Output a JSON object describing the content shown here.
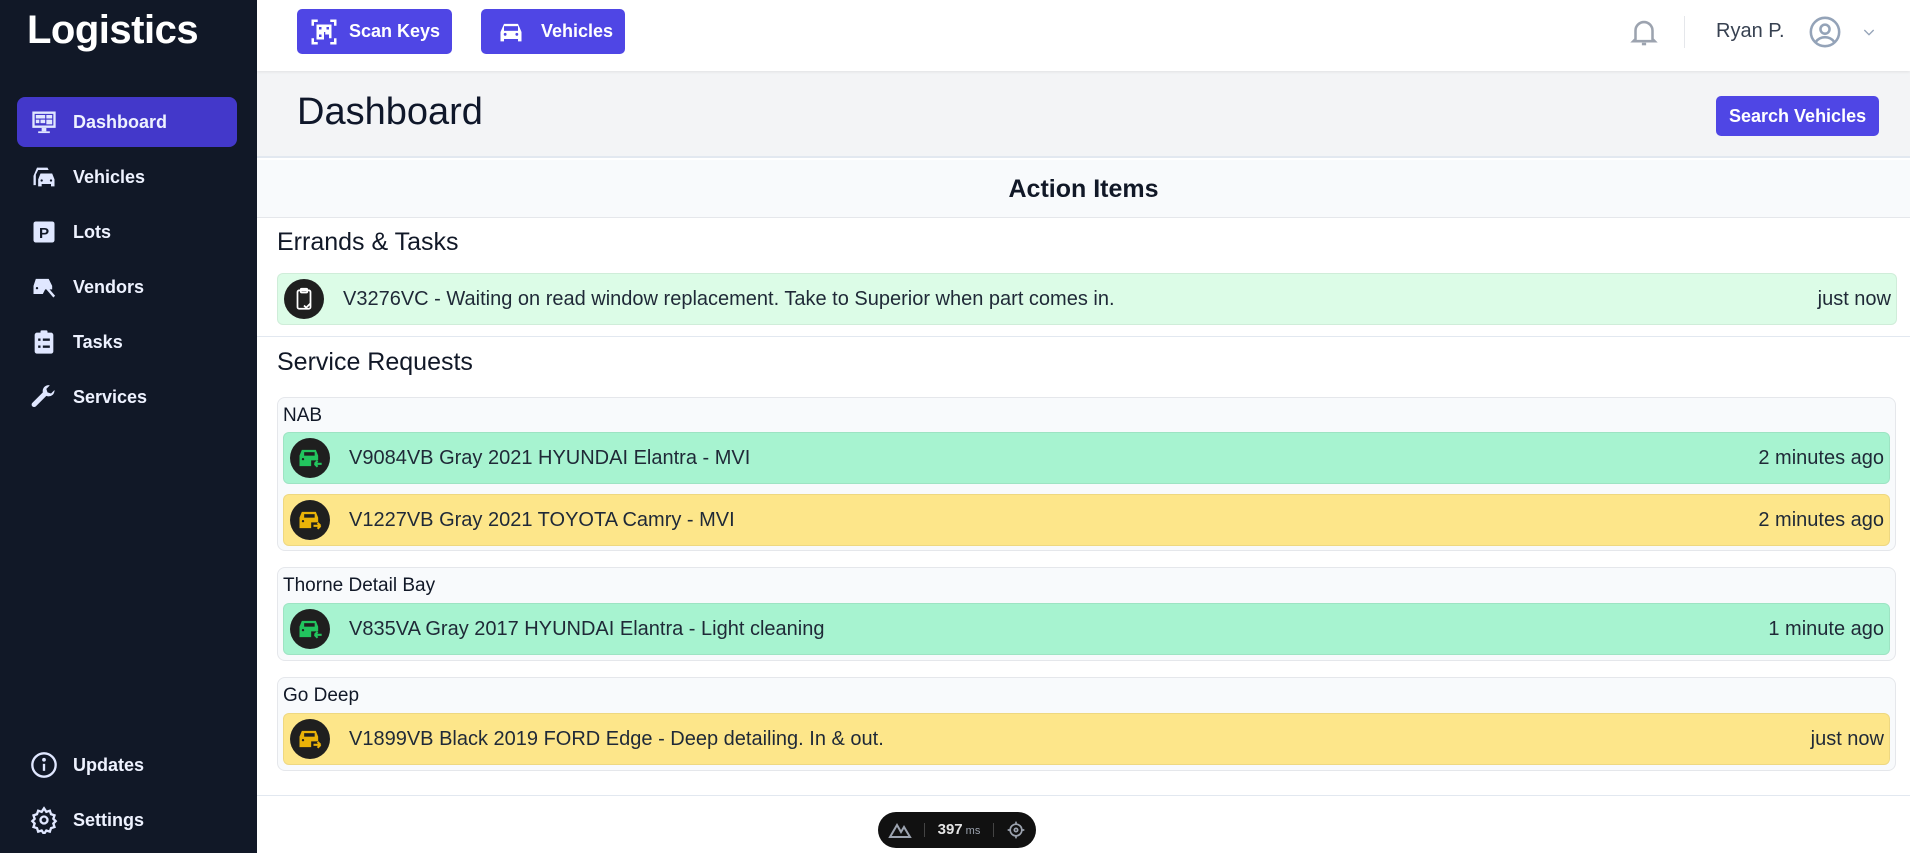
{
  "app": {
    "brand": "Logistics"
  },
  "sidebar": {
    "items": [
      {
        "label": "Dashboard",
        "icon": "monitor-dashboard-icon",
        "active": true
      },
      {
        "label": "Vehicles",
        "icon": "cars-icon",
        "active": false
      },
      {
        "label": "Lots",
        "icon": "parking-icon",
        "active": false
      },
      {
        "label": "Vendors",
        "icon": "car-wrench-icon",
        "active": false
      },
      {
        "label": "Tasks",
        "icon": "clipboard-list-icon",
        "active": false
      },
      {
        "label": "Services",
        "icon": "wrench-icon",
        "active": false
      }
    ],
    "bottom_items": [
      {
        "label": "Updates",
        "icon": "info-circle-icon"
      },
      {
        "label": "Settings",
        "icon": "gear-icon"
      }
    ]
  },
  "topbar": {
    "scan_keys_label": "Scan Keys",
    "vehicles_label": "Vehicles",
    "user_name": "Ryan P."
  },
  "page": {
    "title": "Dashboard",
    "search_button": "Search Vehicles"
  },
  "action_items": {
    "title": "Action Items",
    "errands": {
      "title": "Errands & Tasks",
      "items": [
        {
          "text": "V3276VC - Waiting on read window replacement. Take to Superior when part comes in.",
          "time": "just now",
          "status": "task"
        }
      ]
    },
    "service_requests": {
      "title": "Service Requests",
      "groups": [
        {
          "vendor": "NAB",
          "items": [
            {
              "text": "V9084VB Gray 2021 HYUNDAI Elantra - MVI",
              "time": "2 minutes ago",
              "direction": "incoming",
              "color": "#a7f3d0"
            },
            {
              "text": "V1227VB Gray 2021 TOYOTA Camry - MVI",
              "time": "2 minutes ago",
              "direction": "outgoing",
              "color": "#fde68a"
            }
          ]
        },
        {
          "vendor": "Thorne Detail Bay",
          "items": [
            {
              "text": "V835VA Gray 2017 HYUNDAI Elantra - Light cleaning",
              "time": "1 minute ago",
              "direction": "incoming",
              "color": "#a7f3d0"
            }
          ]
        },
        {
          "vendor": "Go Deep",
          "items": [
            {
              "text": "V1899VB Black 2019 FORD Edge - Deep detailing. In & out.",
              "time": "just now",
              "direction": "outgoing",
              "color": "#fde68a"
            }
          ]
        }
      ]
    }
  },
  "perf": {
    "value": "397",
    "unit": "ms"
  },
  "colors": {
    "accent": "#4f46e5",
    "sidebar_active": "#4338ca",
    "sidebar_bg": "#111827",
    "incoming": "#22c55e",
    "outgoing": "#eab308"
  }
}
